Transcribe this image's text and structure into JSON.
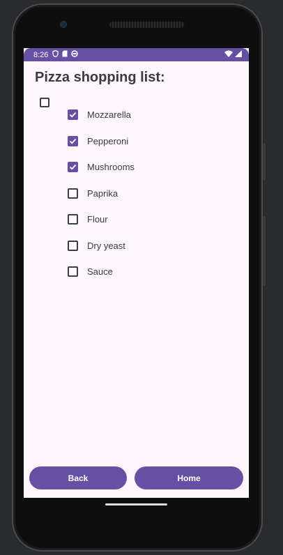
{
  "status_bar": {
    "time": "8:26",
    "left_icons": [
      "shield-icon",
      "sim-icon",
      "sync-icon"
    ],
    "right_icons": [
      "wifi-icon",
      "signal-icon"
    ]
  },
  "title": "Pizza shopping list:",
  "select_all_checked": false,
  "items": [
    {
      "label": "Mozzarella",
      "checked": true
    },
    {
      "label": "Pepperoni",
      "checked": true
    },
    {
      "label": "Mushrooms",
      "checked": true
    },
    {
      "label": "Paprika",
      "checked": false
    },
    {
      "label": "Flour",
      "checked": false
    },
    {
      "label": "Dry yeast",
      "checked": false
    },
    {
      "label": "Sauce",
      "checked": false
    }
  ],
  "buttons": {
    "back_label": "Back",
    "home_label": "Home"
  },
  "colors": {
    "primary": "#6650a4",
    "background": "#fdf7fd",
    "text": "#3b3a40"
  }
}
